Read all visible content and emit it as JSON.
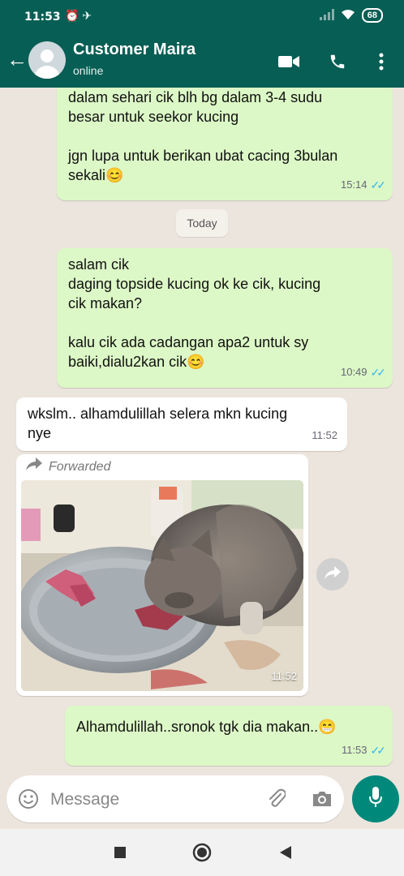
{
  "status_bar": {
    "time": "11:53",
    "icons": [
      "alarm-icon",
      "telegram-icon"
    ],
    "battery": "68"
  },
  "header": {
    "contact_name": "Customer Maira",
    "status": "online"
  },
  "messages": [
    {
      "direction": "outgoing",
      "text": "dalam sehari cik blh bg dalam 3-4 sudu\nbesar untuk seekor kucing\n\njgn lupa untuk berikan ubat cacing 3bulan\nsekali😊",
      "time": "15:14",
      "read": true
    },
    {
      "direction": "outgoing",
      "text": "salam cik\ndaging topside kucing ok ke cik, kucing\ncik makan?\n\nkalu cik ada cadangan apa2 untuk sy\nbaiki,dialu2kan cik😊",
      "time": "10:49",
      "read": true
    },
    {
      "direction": "incoming",
      "text": "wkslm.. alhamdulillah selera mkn kucing\nnye",
      "time": "11:52"
    },
    {
      "direction": "incoming",
      "forwarded_label": "Forwarded",
      "media": "photo",
      "time": "11:52"
    },
    {
      "direction": "outgoing",
      "text": "Alhamdulillah..sronok tgk dia makan..😁",
      "time": "11:53",
      "read": true
    }
  ],
  "date_divider": "Today",
  "composer": {
    "placeholder": "Message"
  },
  "colors": {
    "header": "#075e54",
    "outgoing_bubble": "#dcf8c6",
    "incoming_bubble": "#ffffff",
    "read_ticks": "#34b7f1",
    "mic_button": "#00897b",
    "chat_background": "#ece5dd"
  }
}
